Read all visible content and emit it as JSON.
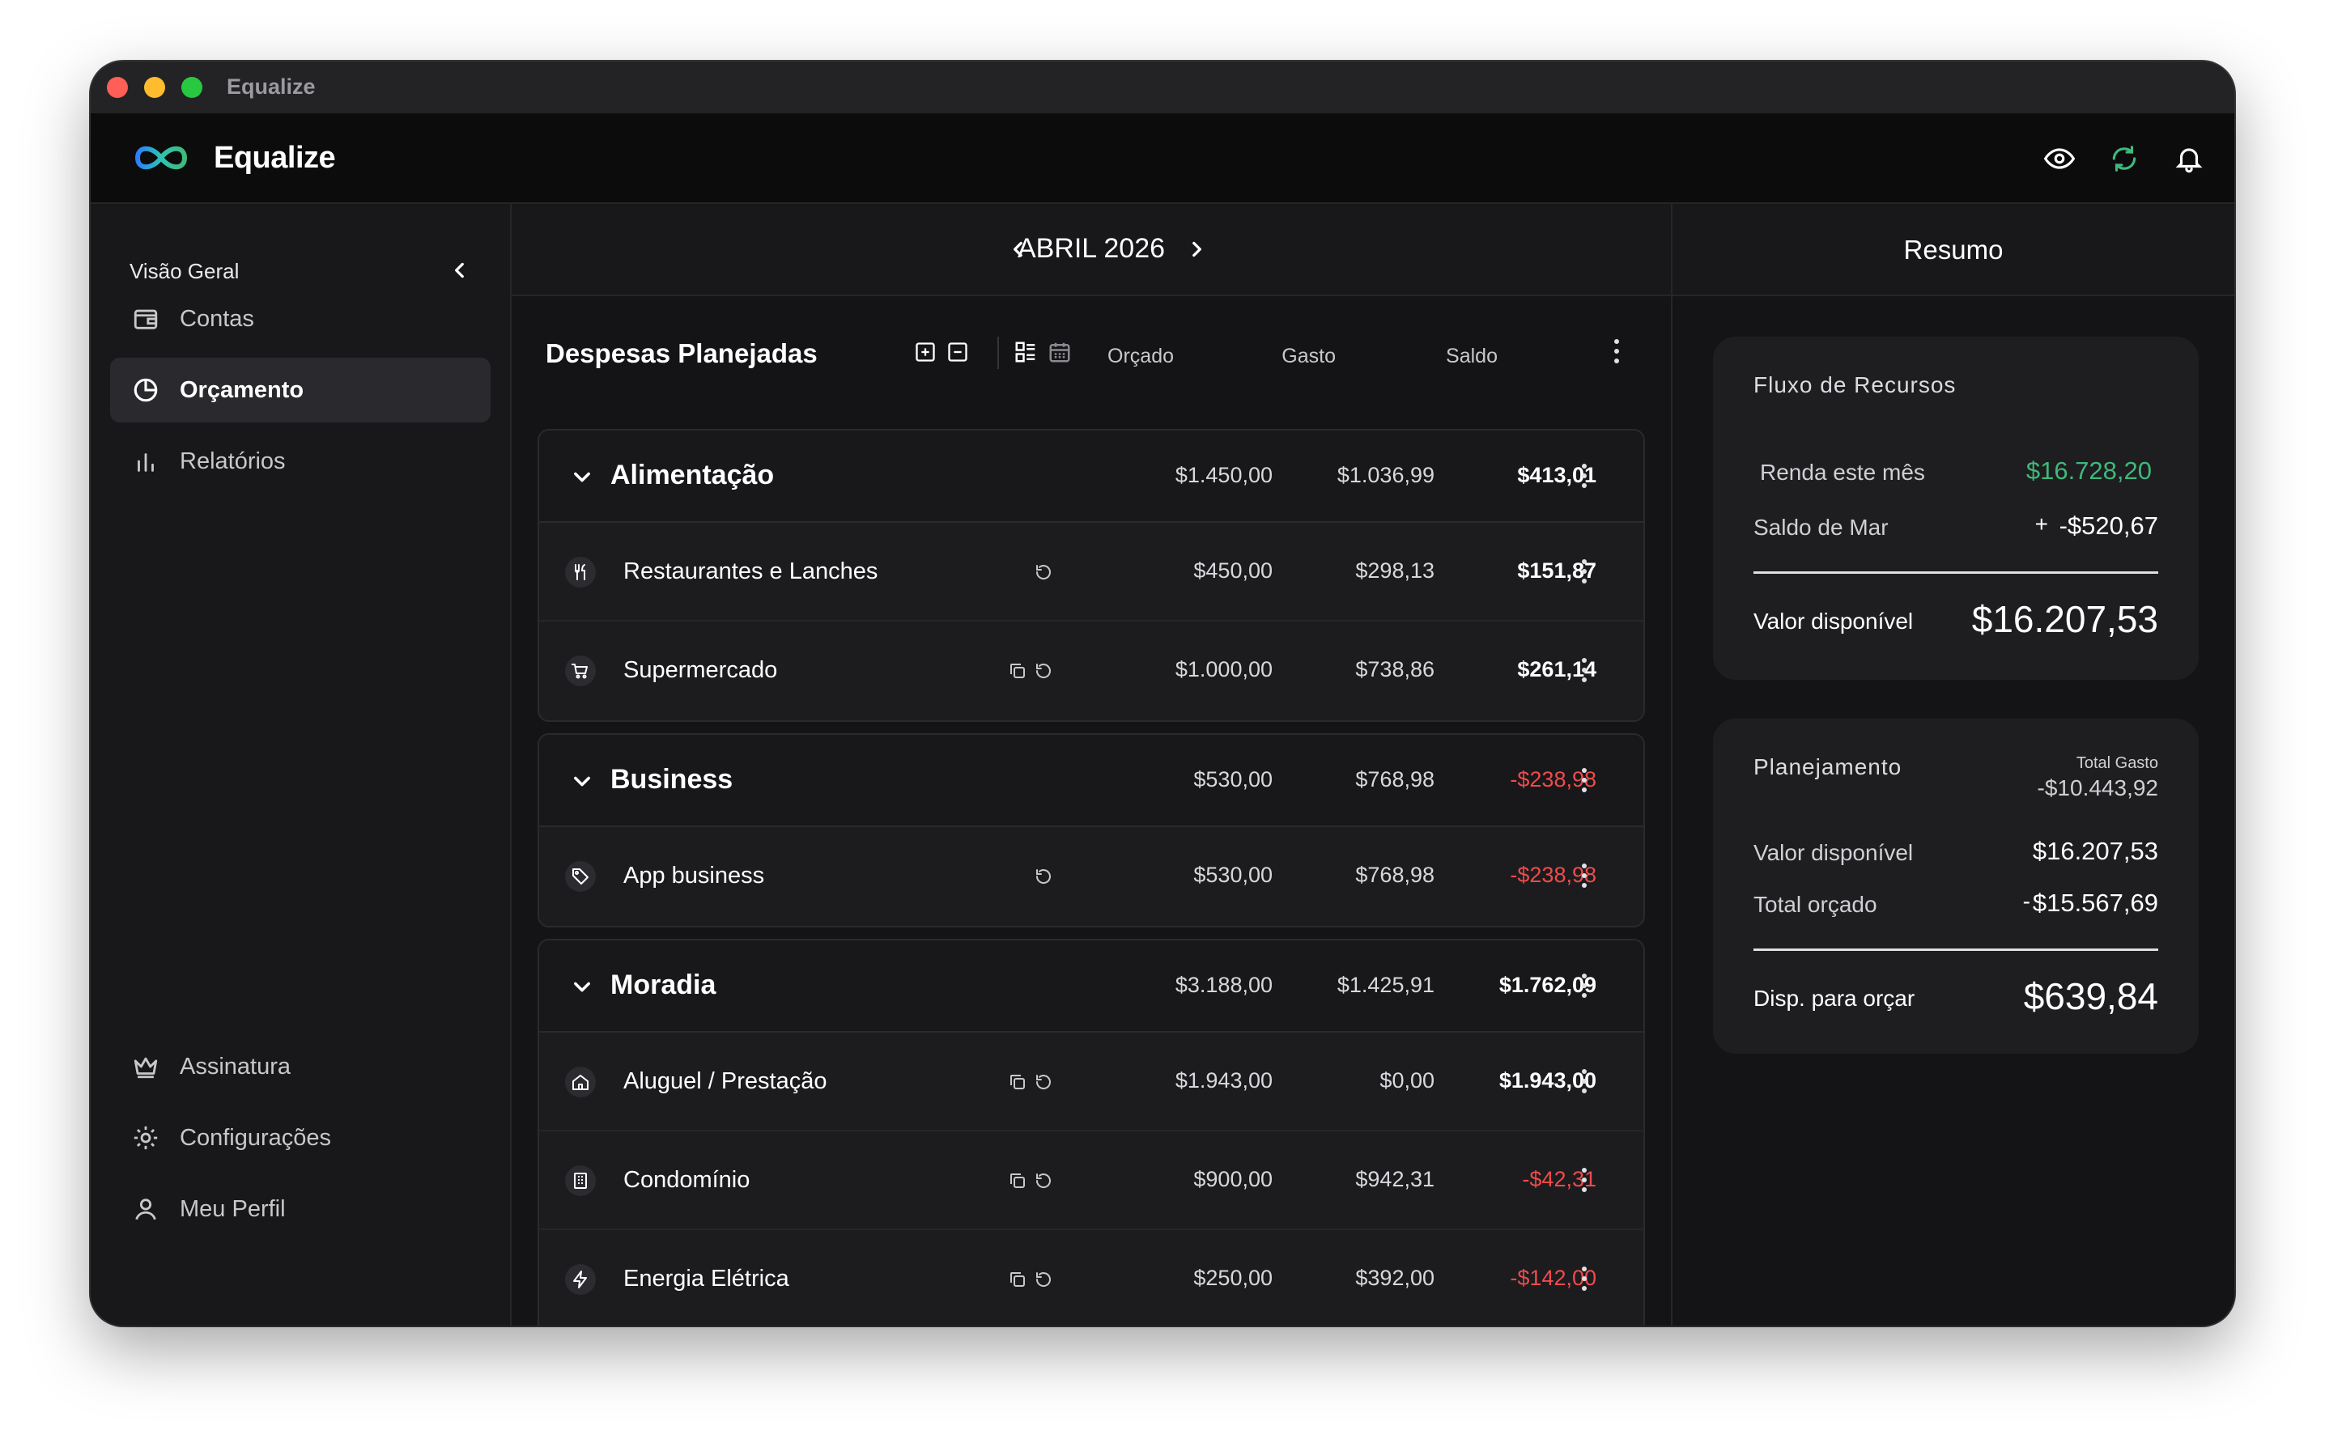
{
  "window": {
    "title": "Equalize"
  },
  "app": {
    "brand": "Equalize",
    "accent": "#3fb97a",
    "negative": "#ef4b4b"
  },
  "topbar": {
    "icons": [
      "eye-icon",
      "refresh-icon",
      "bell-icon"
    ]
  },
  "sidebar": {
    "header": "Visão Geral",
    "items": [
      {
        "label": "Contas",
        "icon": "wallet-icon"
      },
      {
        "label": "Orçamento",
        "icon": "pie-chart-icon",
        "active": true
      },
      {
        "label": "Relatórios",
        "icon": "bar-chart-icon"
      }
    ],
    "bottom_items": [
      {
        "label": "Assinatura",
        "icon": "crown-icon"
      },
      {
        "label": "Configurações",
        "icon": "gear-icon"
      },
      {
        "label": "Meu Perfil",
        "icon": "user-icon"
      }
    ]
  },
  "month": {
    "label": "ABRIL 2026"
  },
  "list": {
    "title": "Despesas Planejadas",
    "columns": {
      "budgeted": "Orçado",
      "spent": "Gasto",
      "balance": "Saldo"
    },
    "groups": [
      {
        "name": "Alimentação",
        "budgeted": "$1.450,00",
        "spent": "$1.036,99",
        "balance": "$413,01",
        "items": [
          {
            "name": "Restaurantes e Lanches",
            "icon": "utensils-icon",
            "budgeted": "$450,00",
            "spent": "$298,13",
            "balance": "$151,87"
          },
          {
            "name": "Supermercado",
            "icon": "cart-icon",
            "budgeted": "$1.000,00",
            "spent": "$738,86",
            "balance": "$261,14"
          }
        ]
      },
      {
        "name": "Business",
        "budgeted": "$530,00",
        "spent": "$768,98",
        "balance": "-$238,98",
        "items": [
          {
            "name": "App business",
            "icon": "tag-icon",
            "budgeted": "$530,00",
            "spent": "$768,98",
            "balance": "-$238,98"
          }
        ]
      },
      {
        "name": "Moradia",
        "budgeted": "$3.188,00",
        "spent": "$1.425,91",
        "balance": "$1.762,09",
        "items": [
          {
            "name": "Aluguel / Prestação",
            "icon": "home-icon",
            "budgeted": "$1.943,00",
            "spent": "$0,00",
            "balance": "$1.943,00"
          },
          {
            "name": "Condomínio",
            "icon": "building-icon",
            "budgeted": "$900,00",
            "spent": "$942,31",
            "balance": "-$42,31"
          },
          {
            "name": "Energia Elétrica",
            "icon": "bolt-icon",
            "budgeted": "$250,00",
            "spent": "$392,00",
            "balance": "-$142,00"
          }
        ]
      }
    ]
  },
  "summary": {
    "title": "Resumo",
    "flow": {
      "title": "Fluxo de Recursos",
      "income_label": "Renda este mês",
      "income_value": "$16.728,20",
      "prev_label": "Saldo de Mar",
      "prev_sign": "+",
      "prev_value": "-$520,67",
      "available_label": "Valor disponível",
      "available_value": "$16.207,53"
    },
    "planning": {
      "title": "Planejamento",
      "spent_total_label": "Total Gasto",
      "spent_total_value": "-$10.443,92",
      "available_label": "Valor disponível",
      "available_value": "$16.207,53",
      "budgeted_label": "Total orçado",
      "budgeted_sign": "-",
      "budgeted_value": "$15.567,69",
      "remaining_label": "Disp. para orçar",
      "remaining_value": "$639,84"
    }
  }
}
